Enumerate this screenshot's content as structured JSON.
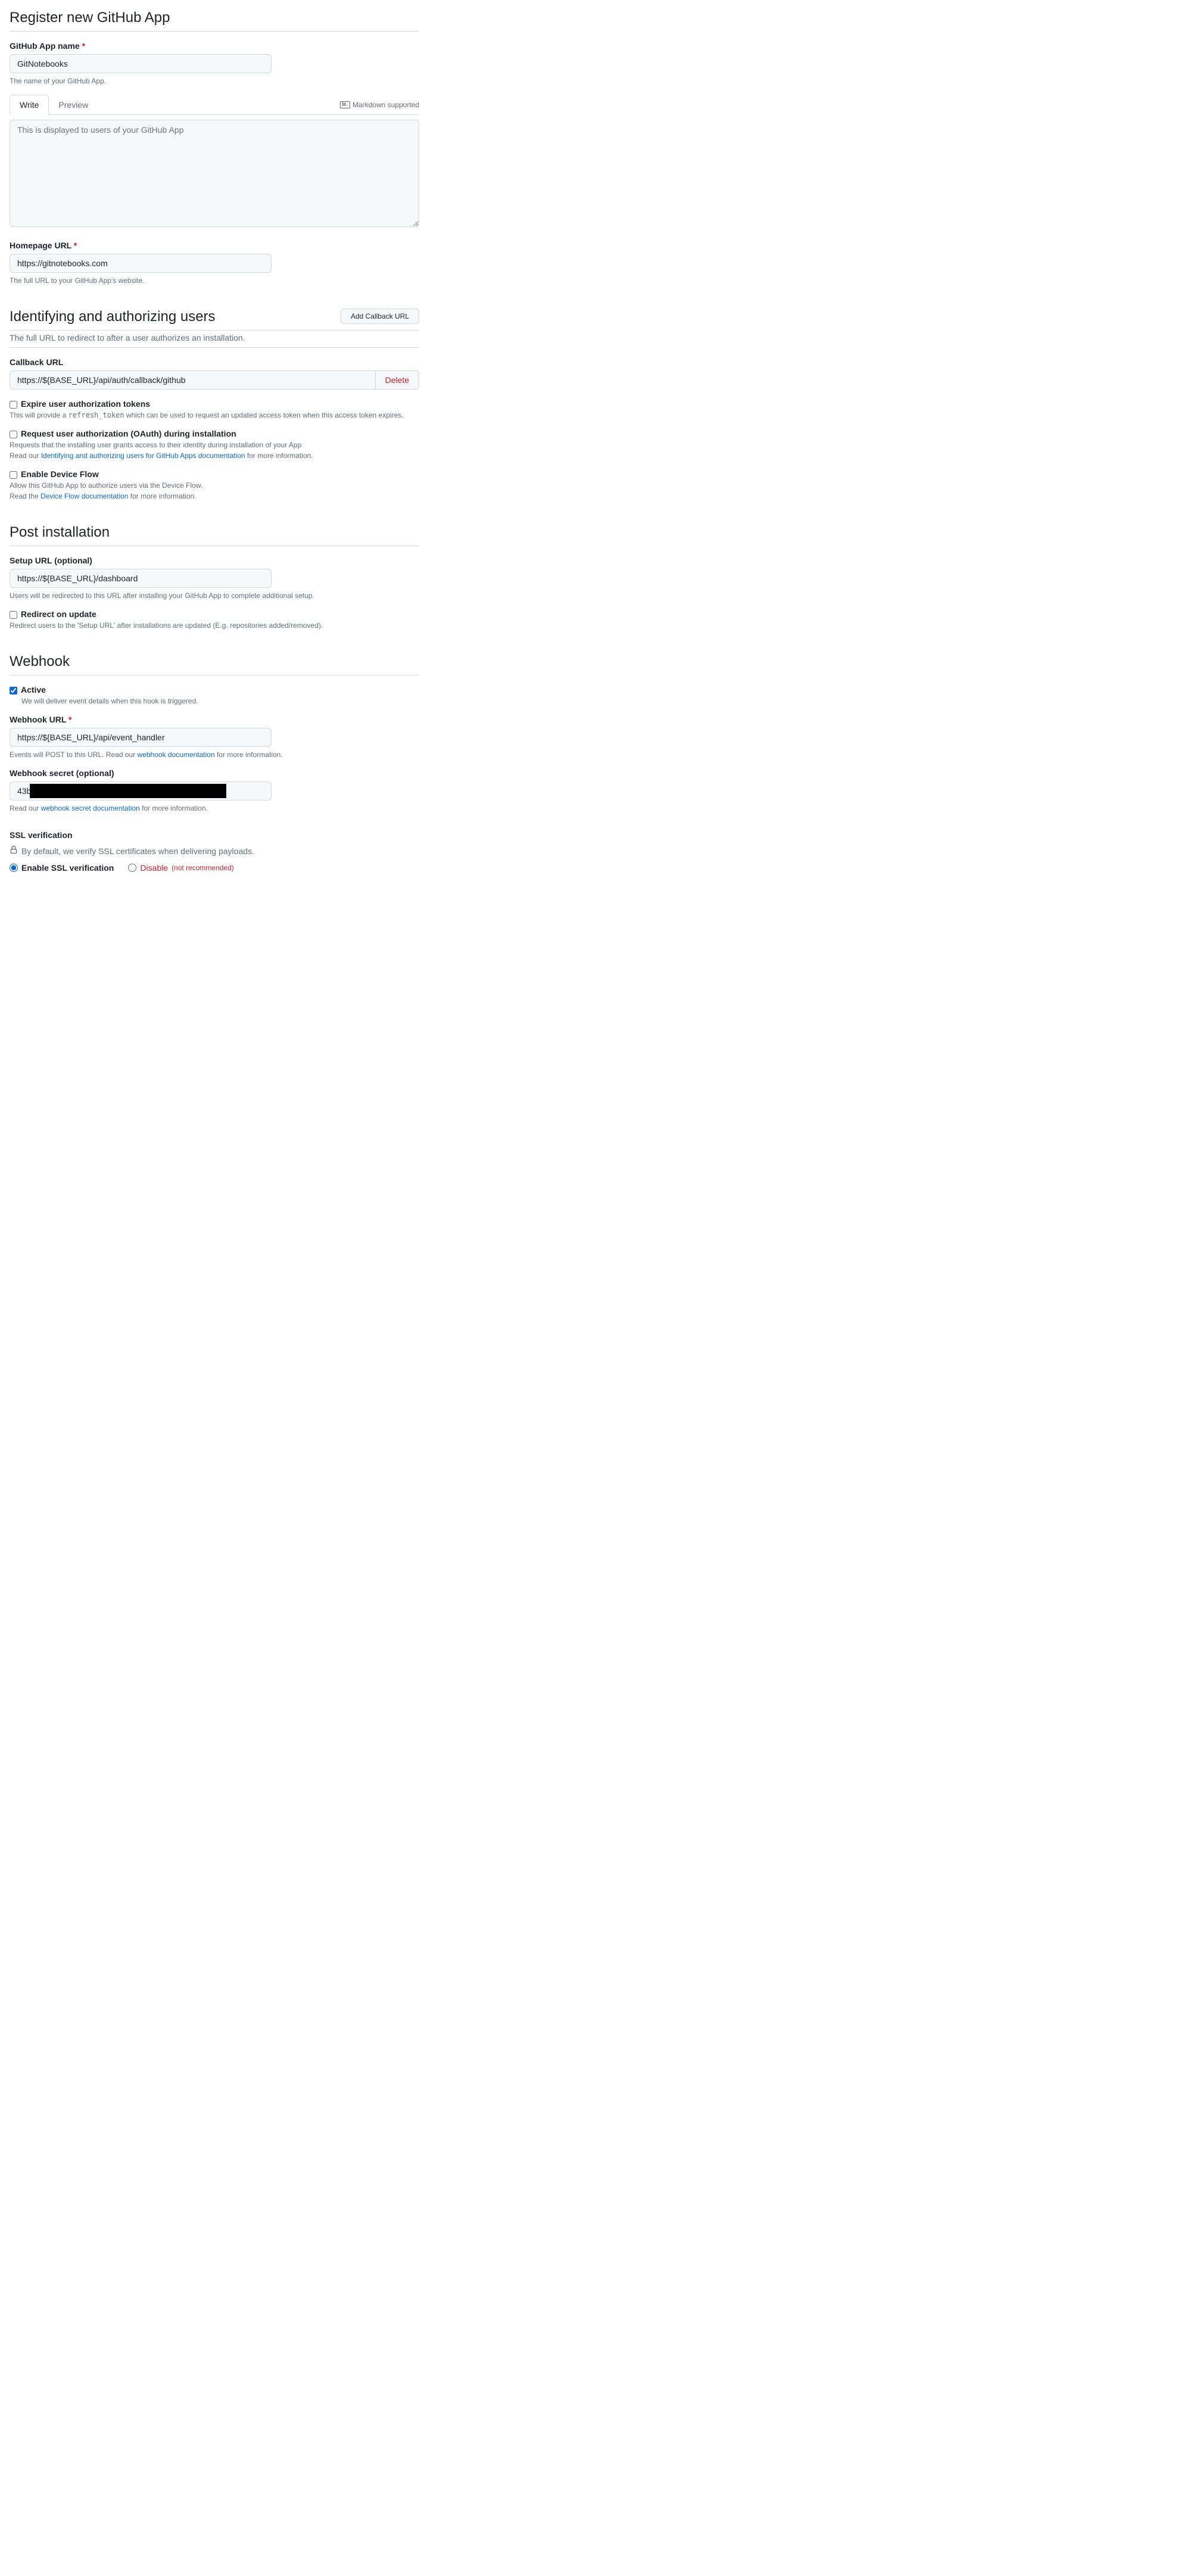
{
  "page": {
    "title": "Register new GitHub App"
  },
  "appName": {
    "label": "GitHub App name",
    "value": "GitNotebooks",
    "help": "The name of your GitHub App."
  },
  "description": {
    "tabs": {
      "write": "Write",
      "preview": "Preview"
    },
    "markdownText": "Markdown supported",
    "placeholder": "This is displayed to users of your GitHub App"
  },
  "homepage": {
    "label": "Homepage URL",
    "value": "https://gitnotebooks.com",
    "help": "The full URL to your GitHub App's website."
  },
  "identifying": {
    "title": "Identifying and authorizing users",
    "subtitle": "The full URL to redirect to after a user authorizes an installation.",
    "addCallback": "Add Callback URL",
    "callback": {
      "label": "Callback URL",
      "value": "https://${BASE_URL}/api/auth/callback/github",
      "delete": "Delete"
    },
    "expire": {
      "label": "Expire user authorization tokens",
      "helpPrefix": "This will provide a ",
      "helpCode": "refresh_token",
      "helpSuffix": " which can be used to request an updated access token when this access token expires."
    },
    "oauth": {
      "label": "Request user authorization (OAuth) during installation",
      "help1": "Requests that the installing user grants access to their identity during installation of your App",
      "help2a": "Read our ",
      "help2link": "Identifying and authorizing users for GitHub Apps documentation",
      "help2b": " for more information."
    },
    "deviceFlow": {
      "label": "Enable Device Flow",
      "help1": "Allow this GitHub App to authorize users via the Device Flow.",
      "help2a": "Read the ",
      "help2link": "Device Flow documentation",
      "help2b": " for more information."
    }
  },
  "postInstall": {
    "title": "Post installation",
    "setup": {
      "label": "Setup URL (optional)",
      "value": "https://${BASE_URL}/dashboard",
      "help": "Users will be redirected to this URL after installing your GitHub App to complete additional setup."
    },
    "redirect": {
      "label": "Redirect on update",
      "help": "Redirect users to the 'Setup URL' after installations are updated (E.g. repositories added/removed)."
    }
  },
  "webhook": {
    "title": "Webhook",
    "active": {
      "label": "Active",
      "help": "We will deliver event details when this hook is triggered."
    },
    "url": {
      "label": "Webhook URL",
      "value": "https://${BASE_URL}/api/event_handler",
      "helpA": "Events will POST to this URL. Read our ",
      "helpLink": "webhook documentation",
      "helpB": " for more information."
    },
    "secret": {
      "label": "Webhook secret (optional)",
      "value": "43b",
      "helpA": "Read our ",
      "helpLink": "webhook secret documentation",
      "helpB": " for more information."
    },
    "ssl": {
      "title": "SSL verification",
      "default": "By default, we verify SSL certificates when delivering payloads.",
      "enable": "Enable SSL verification",
      "disable": "Disable",
      "disableNote": "(not recommended)"
    }
  }
}
